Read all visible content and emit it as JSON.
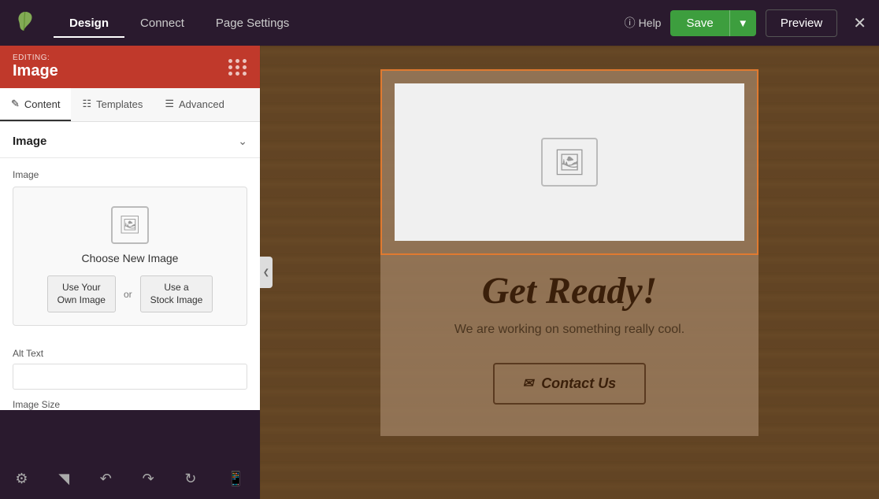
{
  "topNav": {
    "tabs": [
      {
        "id": "design",
        "label": "Design",
        "active": true
      },
      {
        "id": "connect",
        "label": "Connect",
        "active": false
      },
      {
        "id": "page-settings",
        "label": "Page Settings",
        "active": false
      }
    ],
    "helpLabel": "Help",
    "saveLabel": "Save",
    "previewLabel": "Preview"
  },
  "editingHeader": {
    "editingLabel": "EDITING:",
    "editingTitle": "Image"
  },
  "subTabs": [
    {
      "id": "content",
      "label": "Content",
      "active": true
    },
    {
      "id": "templates",
      "label": "Templates",
      "active": false
    },
    {
      "id": "advanced",
      "label": "Advanced",
      "active": false
    }
  ],
  "panel": {
    "sectionTitle": "Image",
    "imageFieldLabel": "Image",
    "chooseNewImageLabel": "Choose New Image",
    "useYourOwnLabel": "Use Your\nOwn Image",
    "orLabel": "or",
    "useStockLabel": "Use a\nStock Image",
    "altTextLabel": "Alt Text",
    "altTextPlaceholder": "",
    "imageSizeLabel": "Image Size"
  },
  "canvas": {
    "headlineText": "Get Ready!",
    "subtextContent": "We are working on something really cool.",
    "contactButtonLabel": "Contact Us"
  },
  "toolbar": {
    "icons": [
      "settings",
      "layers",
      "history-back",
      "history-forward",
      "refresh",
      "mobile"
    ]
  }
}
